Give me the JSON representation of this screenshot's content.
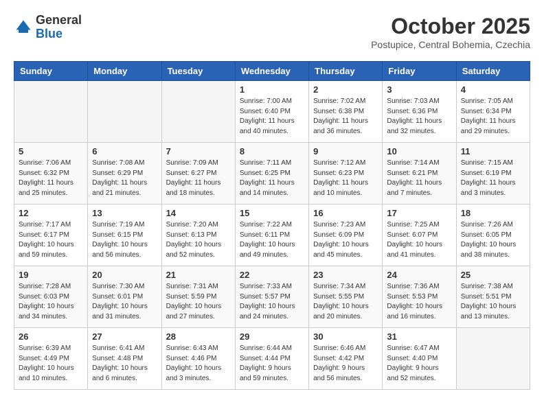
{
  "header": {
    "logo_general": "General",
    "logo_blue": "Blue",
    "month_title": "October 2025",
    "subtitle": "Postupice, Central Bohemia, Czechia"
  },
  "weekdays": [
    "Sunday",
    "Monday",
    "Tuesday",
    "Wednesday",
    "Thursday",
    "Friday",
    "Saturday"
  ],
  "weeks": [
    [
      {
        "day": "",
        "info": ""
      },
      {
        "day": "",
        "info": ""
      },
      {
        "day": "",
        "info": ""
      },
      {
        "day": "1",
        "info": "Sunrise: 7:00 AM\nSunset: 6:40 PM\nDaylight: 11 hours\nand 40 minutes."
      },
      {
        "day": "2",
        "info": "Sunrise: 7:02 AM\nSunset: 6:38 PM\nDaylight: 11 hours\nand 36 minutes."
      },
      {
        "day": "3",
        "info": "Sunrise: 7:03 AM\nSunset: 6:36 PM\nDaylight: 11 hours\nand 32 minutes."
      },
      {
        "day": "4",
        "info": "Sunrise: 7:05 AM\nSunset: 6:34 PM\nDaylight: 11 hours\nand 29 minutes."
      }
    ],
    [
      {
        "day": "5",
        "info": "Sunrise: 7:06 AM\nSunset: 6:32 PM\nDaylight: 11 hours\nand 25 minutes."
      },
      {
        "day": "6",
        "info": "Sunrise: 7:08 AM\nSunset: 6:29 PM\nDaylight: 11 hours\nand 21 minutes."
      },
      {
        "day": "7",
        "info": "Sunrise: 7:09 AM\nSunset: 6:27 PM\nDaylight: 11 hours\nand 18 minutes."
      },
      {
        "day": "8",
        "info": "Sunrise: 7:11 AM\nSunset: 6:25 PM\nDaylight: 11 hours\nand 14 minutes."
      },
      {
        "day": "9",
        "info": "Sunrise: 7:12 AM\nSunset: 6:23 PM\nDaylight: 11 hours\nand 10 minutes."
      },
      {
        "day": "10",
        "info": "Sunrise: 7:14 AM\nSunset: 6:21 PM\nDaylight: 11 hours\nand 7 minutes."
      },
      {
        "day": "11",
        "info": "Sunrise: 7:15 AM\nSunset: 6:19 PM\nDaylight: 11 hours\nand 3 minutes."
      }
    ],
    [
      {
        "day": "12",
        "info": "Sunrise: 7:17 AM\nSunset: 6:17 PM\nDaylight: 10 hours\nand 59 minutes."
      },
      {
        "day": "13",
        "info": "Sunrise: 7:19 AM\nSunset: 6:15 PM\nDaylight: 10 hours\nand 56 minutes."
      },
      {
        "day": "14",
        "info": "Sunrise: 7:20 AM\nSunset: 6:13 PM\nDaylight: 10 hours\nand 52 minutes."
      },
      {
        "day": "15",
        "info": "Sunrise: 7:22 AM\nSunset: 6:11 PM\nDaylight: 10 hours\nand 49 minutes."
      },
      {
        "day": "16",
        "info": "Sunrise: 7:23 AM\nSunset: 6:09 PM\nDaylight: 10 hours\nand 45 minutes."
      },
      {
        "day": "17",
        "info": "Sunrise: 7:25 AM\nSunset: 6:07 PM\nDaylight: 10 hours\nand 41 minutes."
      },
      {
        "day": "18",
        "info": "Sunrise: 7:26 AM\nSunset: 6:05 PM\nDaylight: 10 hours\nand 38 minutes."
      }
    ],
    [
      {
        "day": "19",
        "info": "Sunrise: 7:28 AM\nSunset: 6:03 PM\nDaylight: 10 hours\nand 34 minutes."
      },
      {
        "day": "20",
        "info": "Sunrise: 7:30 AM\nSunset: 6:01 PM\nDaylight: 10 hours\nand 31 minutes."
      },
      {
        "day": "21",
        "info": "Sunrise: 7:31 AM\nSunset: 5:59 PM\nDaylight: 10 hours\nand 27 minutes."
      },
      {
        "day": "22",
        "info": "Sunrise: 7:33 AM\nSunset: 5:57 PM\nDaylight: 10 hours\nand 24 minutes."
      },
      {
        "day": "23",
        "info": "Sunrise: 7:34 AM\nSunset: 5:55 PM\nDaylight: 10 hours\nand 20 minutes."
      },
      {
        "day": "24",
        "info": "Sunrise: 7:36 AM\nSunset: 5:53 PM\nDaylight: 10 hours\nand 16 minutes."
      },
      {
        "day": "25",
        "info": "Sunrise: 7:38 AM\nSunset: 5:51 PM\nDaylight: 10 hours\nand 13 minutes."
      }
    ],
    [
      {
        "day": "26",
        "info": "Sunrise: 6:39 AM\nSunset: 4:49 PM\nDaylight: 10 hours\nand 10 minutes."
      },
      {
        "day": "27",
        "info": "Sunrise: 6:41 AM\nSunset: 4:48 PM\nDaylight: 10 hours\nand 6 minutes."
      },
      {
        "day": "28",
        "info": "Sunrise: 6:43 AM\nSunset: 4:46 PM\nDaylight: 10 hours\nand 3 minutes."
      },
      {
        "day": "29",
        "info": "Sunrise: 6:44 AM\nSunset: 4:44 PM\nDaylight: 9 hours\nand 59 minutes."
      },
      {
        "day": "30",
        "info": "Sunrise: 6:46 AM\nSunset: 4:42 PM\nDaylight: 9 hours\nand 56 minutes."
      },
      {
        "day": "31",
        "info": "Sunrise: 6:47 AM\nSunset: 4:40 PM\nDaylight: 9 hours\nand 52 minutes."
      },
      {
        "day": "",
        "info": ""
      }
    ]
  ]
}
